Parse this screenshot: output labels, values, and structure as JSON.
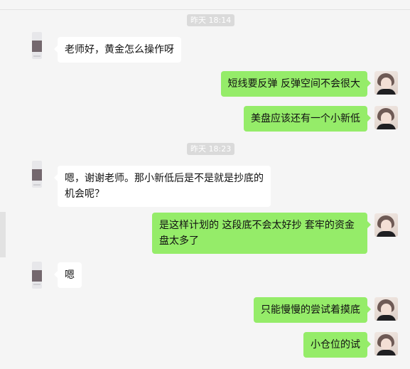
{
  "chat": {
    "timestamps": [
      "昨天 18:14",
      "昨天 18:23"
    ],
    "messages": [
      {
        "from": "contact",
        "text": "老师好，黄金怎么操作呀"
      },
      {
        "from": "me",
        "text": "短线要反弹  反弹空间不会很大"
      },
      {
        "from": "me",
        "text": "美盘应该还有一个小新低"
      },
      {
        "from": "contact",
        "text": "嗯，谢谢老师。那小新低后是不是就是抄底的机会呢？",
        "lines": [
          "嗯，谢谢老师。那小新低后是不是就是抄底的",
          "机会呢？"
        ]
      },
      {
        "from": "me",
        "text": "是这样计划的  这段底不会太好抄  套牢的资金盘太多了",
        "lines": [
          "是这样计划的  这段底不会太好抄  套牢的资金",
          "盘太多了"
        ]
      },
      {
        "from": "contact",
        "text": "嗯"
      },
      {
        "from": "me",
        "text": "只能慢慢的尝试着摸底"
      },
      {
        "from": "me",
        "text": "小仓位的试"
      }
    ]
  },
  "colors": {
    "background": "#f5f5f5",
    "bubble_me": "#95ec69",
    "bubble_contact": "#ffffff",
    "timestamp_bg": "#dadada"
  }
}
